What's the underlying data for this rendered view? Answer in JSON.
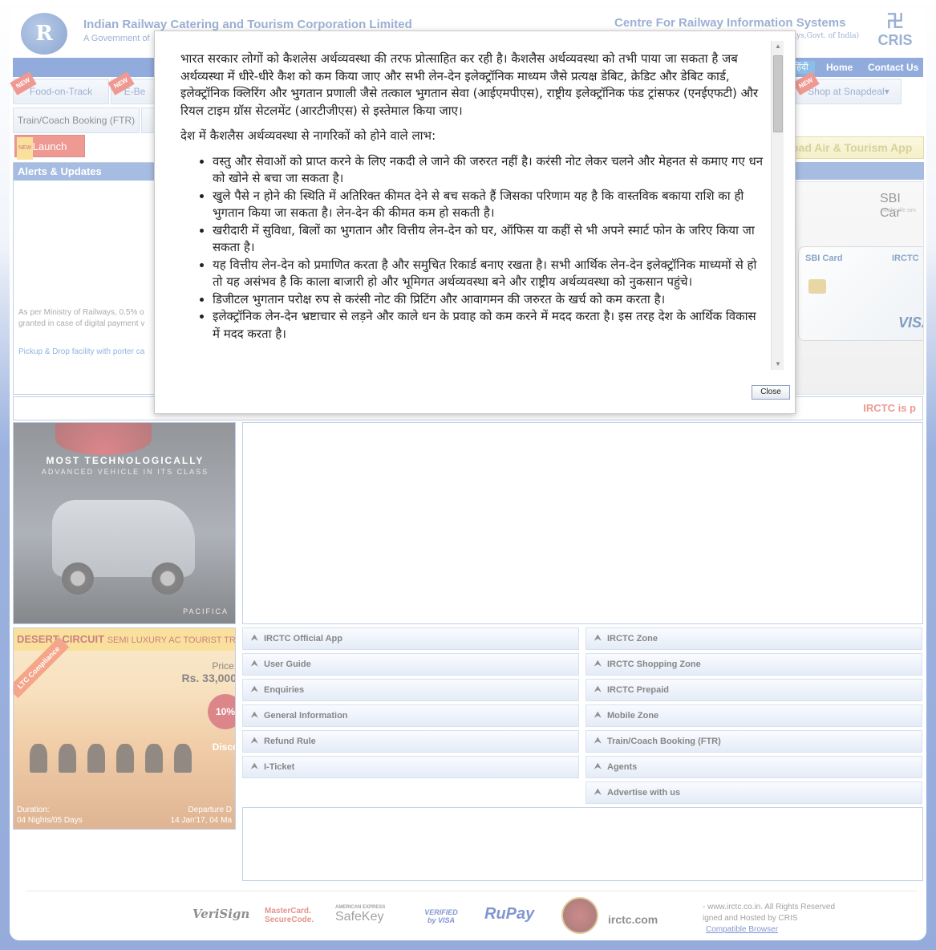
{
  "header": {
    "org_title": "Indian Railway Catering and Tourism Corporation Limited",
    "org_sub": "A Government of",
    "cris_title": "Centre For Railway Information Systems",
    "cris_sub": "ways,Govt. of India)",
    "cris_logo": "CRIS"
  },
  "nav": {
    "hindi": "हिंदी",
    "home": "Home",
    "contact": "Contact Us"
  },
  "tabs": {
    "food": "Food-on-Track",
    "ebooking": "E-Be",
    "shop": "Shop at Snapdeal",
    "ftr": "Train/Coach Booking (FTR)",
    "launch": "Launch",
    "new_badge": "NEW",
    "app_banner": "oad Air & Tourism App"
  },
  "alerts": {
    "title": "Alerts & Updates",
    "text1": "As per Ministry of Railways, 0.5% o",
    "text2": "granted in case of digital payment v",
    "link": "Pickup & Drop facility with porter ca"
  },
  "sbi": {
    "title": "SBI Car",
    "tag": "Make life sim",
    "card_label": "SBI Card",
    "card_label2": "IRCTC",
    "visa": "VISA"
  },
  "ticker": "IRCTC is p",
  "ad1": {
    "line1": "MOST TECHNOLOGICALLY",
    "line2": "ADVANCED VEHICLE IN ITS CLASS",
    "brand": "PACIFICA"
  },
  "ad2": {
    "title": "DESERT CIRCUIT",
    "subtitle": "SEMI LUXURY AC TOURIST TR",
    "ltc": "LTC Compliance",
    "price_label": "Price:",
    "price": "Rs. 33,000",
    "discount": "10% Disco",
    "duration_label": "Duration:",
    "duration": "04 Nights/05 Days",
    "departure_label": "Departure D",
    "departure": "14 Jan'17, 04 Ma"
  },
  "links_left": [
    "IRCTC Official App",
    "User Guide",
    "Enquiries",
    "General Information",
    "Refund Rule",
    "I-Ticket"
  ],
  "links_right": [
    "IRCTC Zone",
    "IRCTC Shopping Zone",
    "IRCTC Prepaid",
    "Mobile Zone",
    "Train/Coach Booking (FTR)",
    "Agents",
    "Advertise with us"
  ],
  "footer": {
    "logos": [
      "VeriSign",
      "MasterCard. SecureCode.",
      "SafeKey",
      "VERIFIED by VISA",
      "RuPay",
      "irctc.com"
    ],
    "amex": "AMERICAN EXPRESS",
    "copy1": "- www.irctc.co.in. All Rights Reserved",
    "copy2": "igned and Hosted by CRIS",
    "copy3": "Compatible Browser"
  },
  "modal": {
    "para1": "भारत सरकार लोगों को कैशलेस अर्थव्यवस्था की तरफ प्रोत्साहित कर रही है। कैशलैस अर्थव्यवस्था को तभी पाया जा सकता है जब अर्थव्यस्था में धीरे-धीरे कैश को कम किया जाए और सभी लेन-देन इलेक्ट्रॉनिक माध्यम जैसे प्रत्यक्ष डेबिट, क्रेडिट और डेबिट कार्ड, इलेक्ट्रॉनिक क्लिरिंग और भुगतान प्रणाली जैसे तत्काल भुगतान सेवा (आईएमपीएस), राष्ट्रीय इलेक्ट्रॉनिक फंड ट्रांसफर (एनईएफटी) और रियल टाइम ग्रॉस सेटलमेंट (आरटीजीएस) से इस्तेमाल किया जाए।",
    "para2": "देश में कैशलैस अर्थव्यवस्था से नागरिकों को होने वाले लाभ:",
    "bullets": [
      "वस्तु और सेवाओं को प्राप्त करने के लिए नकदी ले जाने की जरुरत नहीं है। करंसी नोट लेकर चलने और मेहनत से कमाए गए धन को खोने से बचा जा सकता है।",
      "खुले पैसे न होने की स्थिति में अतिरिक्त कीमत देने से बच सकते हैं जिसका परिणाम यह है कि वास्तविक बकाया राशि का ही भुगतान किया जा सकता है। लेन-देन की कीमत कम हो सकती है।",
      "खरीदारी में सुविधा, बिलों का भुगतान और वित्तीय लेन-देन को घर, ऑफिस या कहीं से भी अपने स्मार्ट फोन के जरिए किया जा सकता है।",
      "यह वित्तीय लेन-देन को प्रमाणित करता है और समुचित रिकार्ड बनाए रखता है। सभी आर्थिक लेन-देन इलेक्ट्रॉनिक माध्यमों से हो तो यह असंभव है कि काला बाजारी हो और भूमिगत अर्थव्यवस्था बने और राष्ट्रीय अर्थव्यवस्था को नुकसान पहुंचे।",
      "डिजीटल भुगतान परोक्ष रुप से करंसी नोट की प्रिटिंग और आवागमन की जरुरत के खर्च को कम करता है।",
      "इलेक्ट्रॉनिक लेन-देन भ्रष्टाचार से लड़ने और काले धन के प्रवाह को कम करने में मदद करता है। इस तरह देश के आर्थिक विकास में मदद करता है।"
    ],
    "close_label": "Close"
  }
}
